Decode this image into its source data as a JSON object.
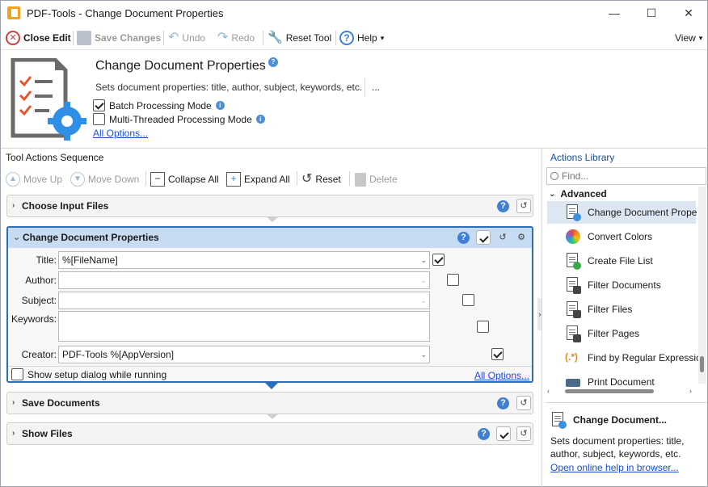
{
  "window": {
    "title": "PDF-Tools - Change Document Properties",
    "minimize": "—",
    "maximize": "☐",
    "close": "✕"
  },
  "toolbar": {
    "close_edit": "Close Edit",
    "save_changes": "Save Changes",
    "undo": "Undo",
    "redo": "Redo",
    "reset_tool": "Reset Tool",
    "help": "Help",
    "view": "View"
  },
  "header": {
    "title": "Change Document Properties",
    "description": "Sets document properties: title, author, subject, keywords, etc.",
    "more": "...",
    "batch_mode": "Batch Processing Mode",
    "multi_thread": "Multi-Threaded Processing Mode",
    "all_options": "All Options..."
  },
  "sequence": {
    "title": "Tool Actions Sequence",
    "move_up": "Move Up",
    "move_down": "Move Down",
    "collapse_all": "Collapse All",
    "expand_all": "Expand All",
    "reset": "Reset",
    "delete": "Delete",
    "actions": [
      {
        "label": "Choose Input Files"
      },
      {
        "label": "Change Document Properties"
      },
      {
        "label": "Save Documents"
      },
      {
        "label": "Show Files"
      }
    ],
    "form": {
      "title_label": "Title:",
      "title_value": "%[FileName]",
      "author_label": "Author:",
      "author_value": "",
      "subject_label": "Subject:",
      "subject_value": "",
      "keywords_label": "Keywords:",
      "keywords_value": "",
      "creator_label": "Creator:",
      "creator_value": "PDF-Tools %[AppVersion]",
      "show_dialog": "Show setup dialog while running",
      "all_options": "All Options..."
    }
  },
  "library": {
    "title": "Actions Library",
    "search_placeholder": "Find...",
    "group": "Advanced",
    "items": [
      {
        "label": "Change Document Prope"
      },
      {
        "label": "Convert Colors"
      },
      {
        "label": "Create File List"
      },
      {
        "label": "Filter Documents"
      },
      {
        "label": "Filter Files"
      },
      {
        "label": "Filter Pages"
      },
      {
        "label": "Find by Regular Expressio"
      },
      {
        "label": "Print Document"
      }
    ],
    "detail_title": "Change Document...",
    "detail_desc": "Sets document properties: title, author, subject, keywords, etc.",
    "detail_link": "Open online help in browser..."
  }
}
